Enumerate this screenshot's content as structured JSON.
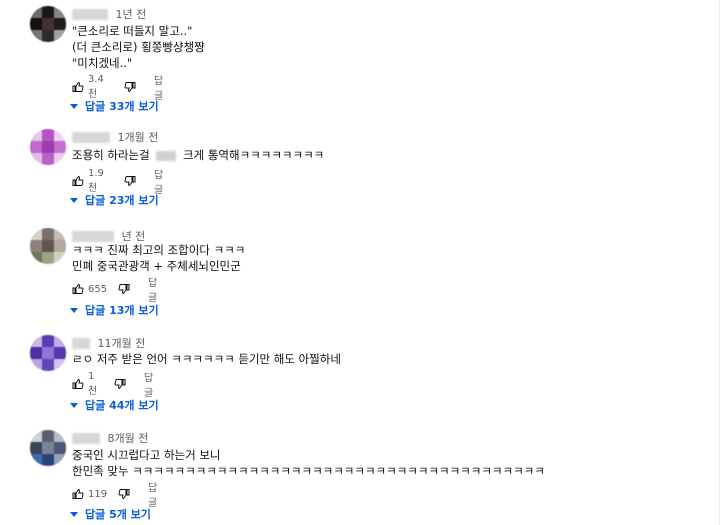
{
  "colors": {
    "link": "#065fd4",
    "meta": "#606060",
    "text": "#0f0f0f"
  },
  "icons": {
    "like": "thumbs-up-icon",
    "dislike": "thumbs-down-icon",
    "expand": "caret-down-icon"
  },
  "comments": [
    {
      "time": "1년 전",
      "lines": [
        "\"큰소리로 떠들지 말고..\"",
        "(더 큰소리로) 횡쫑빵샹챙쨩",
        "\"미치겠네..\""
      ],
      "likes": "3.4천",
      "reply_label": "답글",
      "replies_label": "답글 33개 보기"
    },
    {
      "time": "1개월 전",
      "lines": [
        "조용히 하라는걸",
        "크게 통역해ㅋㅋㅋㅋㅋㅋㅋㅋ"
      ],
      "likes": "1.9천",
      "reply_label": "답글",
      "replies_label": "답글 23개 보기"
    },
    {
      "time": "년 전",
      "lines": [
        "ㅋㅋㅋ 진짜 최고의 조합이다 ㅋㅋㅋ",
        "민폐 중국관광객 + 주체세뇌인민군"
      ],
      "likes": "655",
      "reply_label": "답글",
      "replies_label": "답글 13개 보기"
    },
    {
      "time": "11개월 전",
      "lines": [
        "ㄹㅇ 저주 받은 언어 ㅋㅋㅋㅋㅋㅋ 듣기만 해도 아찔하네"
      ],
      "likes": "1천",
      "reply_label": "답글",
      "replies_label": "답글 44개 보기"
    },
    {
      "time": "8개월 전",
      "lines": [
        "중국인 시끄럽다고 하는거 보니",
        "한민족 맞누 ㅋㅋㅋㅋㅋㅋㅋㅋㅋㅋㅋㅋㅋㅋㅋㅋㅋㅋㅋㅋㅋㅋㅋㅋㅋㅋㅋㅋㅋㅋㅋㅋㅋㅋㅋㅋㅋㅋㅋ"
      ],
      "likes": "119",
      "reply_label": "답글",
      "replies_label": "답글 5개 보기"
    }
  ]
}
